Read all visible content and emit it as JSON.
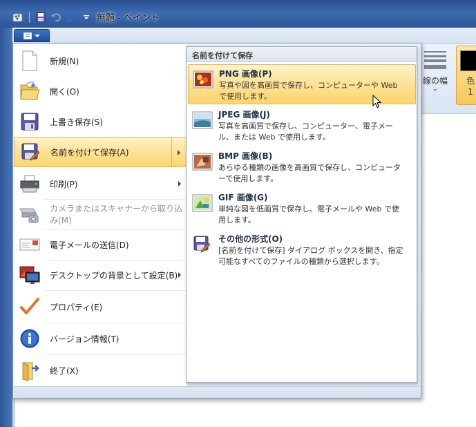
{
  "window": {
    "title": "無題 - ペイント"
  },
  "ribbon": {
    "line_width_label": "線の幅",
    "color1_label": "色\n1",
    "color1_value": "#000000"
  },
  "app_menu": {
    "items": [
      {
        "label": "新規(N)",
        "icon": "new-document-icon",
        "has_submenu": false,
        "disabled": false
      },
      {
        "label": "開く(O)",
        "icon": "open-folder-icon",
        "has_submenu": false,
        "disabled": false
      },
      {
        "label": "上書き保存(S)",
        "icon": "save-disk-icon",
        "has_submenu": false,
        "disabled": false
      },
      {
        "label": "名前を付けて保存(A)",
        "icon": "save-as-icon",
        "has_submenu": true,
        "disabled": false,
        "active": true
      },
      {
        "label": "印刷(P)",
        "icon": "printer-icon",
        "has_submenu": true,
        "disabled": false
      },
      {
        "label": "カメラまたはスキャナーから取り込み(M)",
        "icon": "scanner-camera-icon",
        "has_submenu": false,
        "disabled": true
      },
      {
        "label": "電子メールの送信(D)",
        "icon": "email-icon",
        "has_submenu": false,
        "disabled": false
      },
      {
        "label": "デスクトップの背景として設定(B)",
        "icon": "desktop-background-icon",
        "has_submenu": true,
        "disabled": false
      },
      {
        "label": "プロパティ(E)",
        "icon": "checkmark-icon",
        "has_submenu": false,
        "disabled": false
      },
      {
        "label": "バージョン情報(T)",
        "icon": "info-icon",
        "has_submenu": false,
        "disabled": false
      },
      {
        "label": "終了(X)",
        "icon": "exit-icon",
        "has_submenu": false,
        "disabled": false
      }
    ]
  },
  "save_as_submenu": {
    "header": "名前を付けて保存",
    "items": [
      {
        "title": "PNG 画像(P)",
        "desc": "写真や図を高画質で保存し、コンピューターや Web で使用します。",
        "icon": "png-image-icon",
        "active": true
      },
      {
        "title": "JPEG 画像(J)",
        "desc": "写真を高画質で保存し、コンピューター、電子メール、または Web で使用します。",
        "icon": "jpeg-image-icon",
        "active": false
      },
      {
        "title": "BMP 画像(B)",
        "desc": "あらゆる種類の画像を高画質で保存し、コンピューターで使用します。",
        "icon": "bmp-image-icon",
        "active": false
      },
      {
        "title": "GIF 画像(G)",
        "desc": "単純な図を低画質で保存し、電子メールや Web で使用します。",
        "icon": "gif-image-icon",
        "active": false
      },
      {
        "title": "その他の形式(O)",
        "desc": "[名前を付けて保存] ダイアログ ボックスを開き、指定可能なすべてのファイルの種類から選択します。",
        "icon": "other-formats-icon",
        "active": false
      }
    ]
  }
}
